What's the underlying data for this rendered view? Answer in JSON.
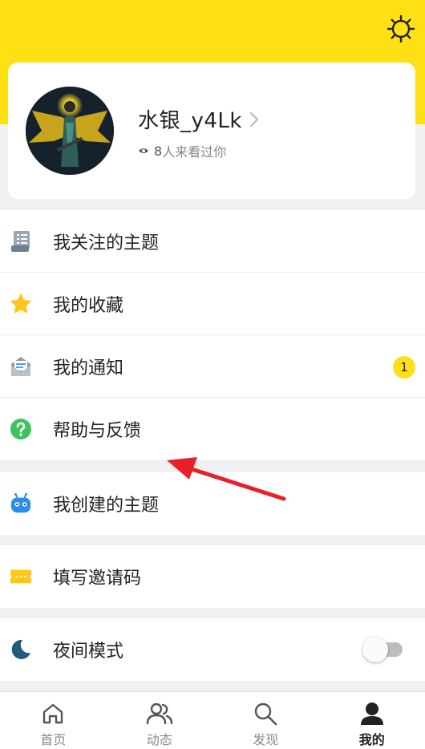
{
  "profile": {
    "username": "水银_y4Lk",
    "visitors_count": "8",
    "visitors_suffix": "人来看过你"
  },
  "menu": {
    "followed_topics": "我关注的主题",
    "favorites": "我的收藏",
    "notifications": "我的通知",
    "notifications_badge": "1",
    "help_feedback": "帮助与反馈",
    "created_topics": "我创建的主题",
    "invite_code": "填写邀请码",
    "night_mode": "夜间模式"
  },
  "night_mode_enabled": false,
  "bottom_nav": {
    "home": "首页",
    "activity": "动态",
    "discover": "发现",
    "mine": "我的"
  },
  "colors": {
    "brand_yellow": "#ffe014",
    "annotation_arrow": "#e8202a"
  },
  "icons": [
    "settings-icon",
    "chevron-right-icon",
    "eye-icon",
    "list-doc-icon",
    "star-icon",
    "mail-icon",
    "help-icon",
    "robot-icon",
    "ticket-icon",
    "moon-icon",
    "home-icon",
    "people-icon",
    "search-icon",
    "user-icon"
  ]
}
